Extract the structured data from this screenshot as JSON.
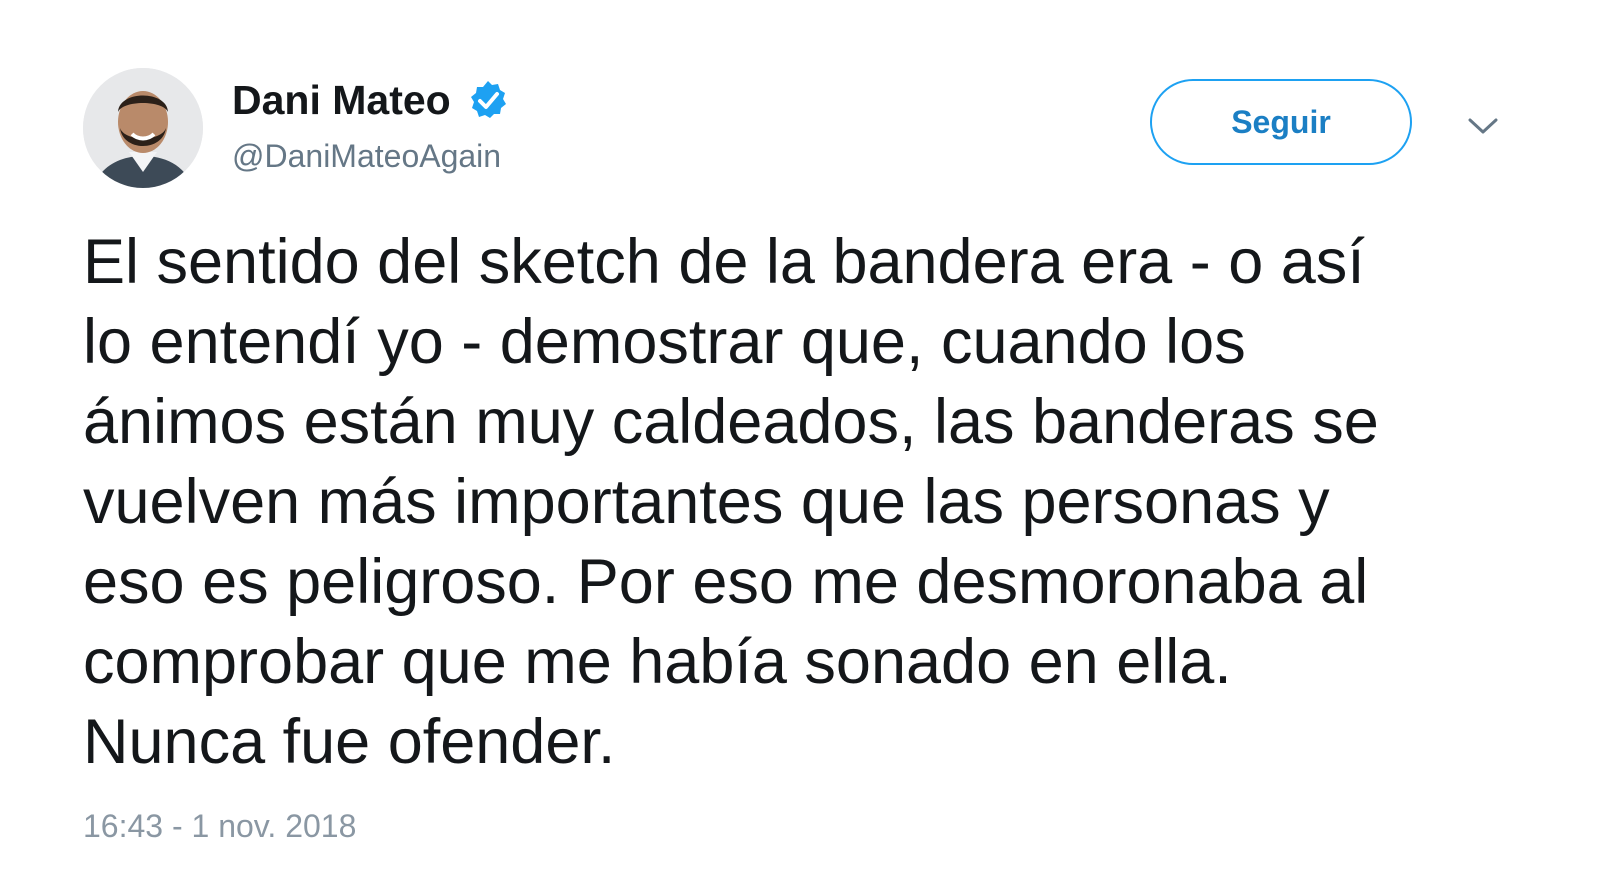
{
  "author": {
    "display_name": "Dani Mateo",
    "handle": "@DaniMateoAgain",
    "verified": true,
    "avatar_icon": "avatar-photo"
  },
  "actions": {
    "follow_label": "Seguir",
    "menu_icon": "chevron-down-icon"
  },
  "tweet": {
    "lines": [
      "El sentido del sketch de la bandera era - o así",
      "lo entendí yo - demostrar que, cuando los",
      "ánimos están muy caldeados, las banderas se",
      "vuelven más importantes que las personas y",
      "eso es peligroso. Por eso me desmoronaba al",
      "comprobar que me había sonado en ella.",
      "Nunca fue ofender."
    ],
    "timestamp": "16:43 - 1 nov. 2018"
  },
  "colors": {
    "accent": "#1da1f2",
    "follow_text": "#1b7fc4",
    "secondary_text": "#657786",
    "primary_text": "#14171a"
  }
}
